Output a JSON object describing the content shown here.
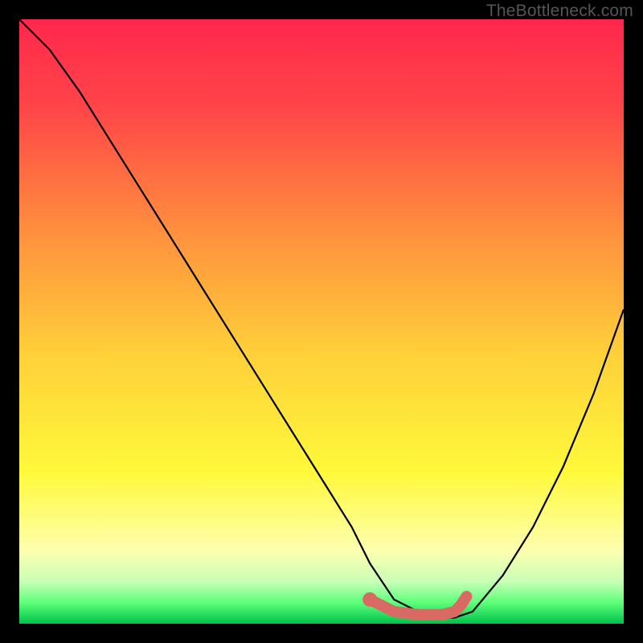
{
  "watermark": "TheBottleneck.com",
  "chart_data": {
    "type": "line",
    "title": "",
    "xlabel": "",
    "ylabel": "",
    "xlim": [
      0,
      100
    ],
    "ylim": [
      0,
      100
    ],
    "series": [
      {
        "name": "bottleneck-curve",
        "x": [
          0,
          5,
          10,
          15,
          20,
          25,
          30,
          35,
          40,
          45,
          50,
          55,
          58,
          62,
          68,
          72,
          75,
          80,
          85,
          90,
          95,
          100
        ],
        "y": [
          100,
          95,
          88,
          80,
          72,
          64,
          56,
          48,
          40,
          32,
          24,
          16,
          10,
          4,
          1,
          1,
          2,
          8,
          16,
          26,
          38,
          52
        ]
      }
    ],
    "highlight": {
      "name": "optimal-range",
      "x": [
        58,
        62,
        66,
        70,
        72,
        73,
        74
      ],
      "y": [
        4,
        2,
        1.5,
        1.5,
        2,
        3,
        4.5
      ],
      "color": "#d86a63"
    },
    "gradient_stops": [
      {
        "offset": 0.0,
        "color": "#ff274c"
      },
      {
        "offset": 0.15,
        "color": "#ff4648"
      },
      {
        "offset": 0.35,
        "color": "#ff8f3e"
      },
      {
        "offset": 0.55,
        "color": "#ffcf3a"
      },
      {
        "offset": 0.75,
        "color": "#fff93a"
      },
      {
        "offset": 0.88,
        "color": "#fdffb0"
      },
      {
        "offset": 0.93,
        "color": "#c8ffb6"
      },
      {
        "offset": 0.965,
        "color": "#5eff7a"
      },
      {
        "offset": 1.0,
        "color": "#00c24b"
      }
    ]
  }
}
